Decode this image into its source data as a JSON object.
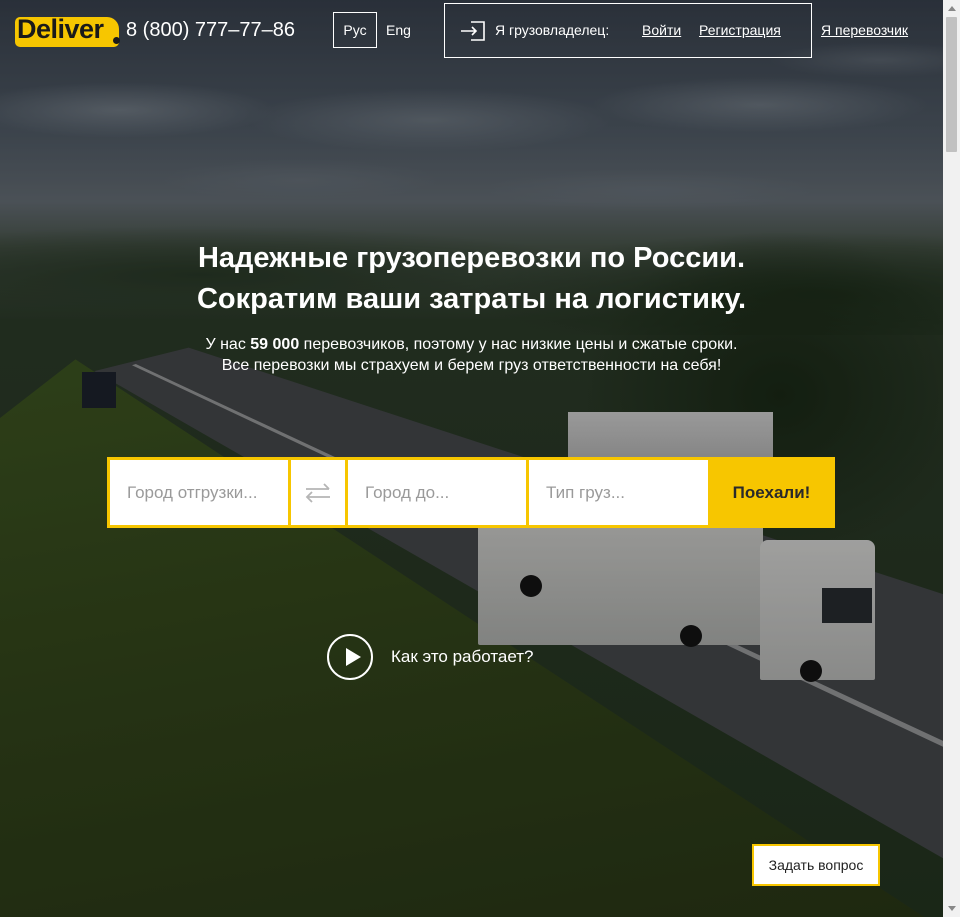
{
  "header": {
    "logo_text": "Deliver",
    "phone": "8 (800) 777–77–86",
    "languages": {
      "active": "Рус",
      "other": "Eng"
    },
    "owner_label": "Я грузовладелец:",
    "login": "Войти",
    "register": "Регистрация",
    "carrier": "Я перевозчик"
  },
  "hero": {
    "title_line1": "Надежные грузоперевозки по России.",
    "title_line2": "Сократим ваши затраты на логистику.",
    "subtitle_prefix": "У нас ",
    "carriers_count": "59 000",
    "subtitle_suffix": " перевозчиков, поэтому у нас низкие цены и сжатые сроки.",
    "subtitle_line2": "Все перевозки мы страхуем и берем груз ответственности на себя!"
  },
  "search": {
    "from_placeholder": "Город отгрузки...",
    "to_placeholder": "Город до...",
    "type_placeholder": "Тип груз...",
    "submit": "Поехали!"
  },
  "how_it_works": "Как это работает?",
  "ask_question": "Задать вопрос",
  "colors": {
    "accent": "#f7c600",
    "text": "#ffffff"
  },
  "icons": [
    "login-icon",
    "swap-arrows-icon",
    "play-icon"
  ]
}
